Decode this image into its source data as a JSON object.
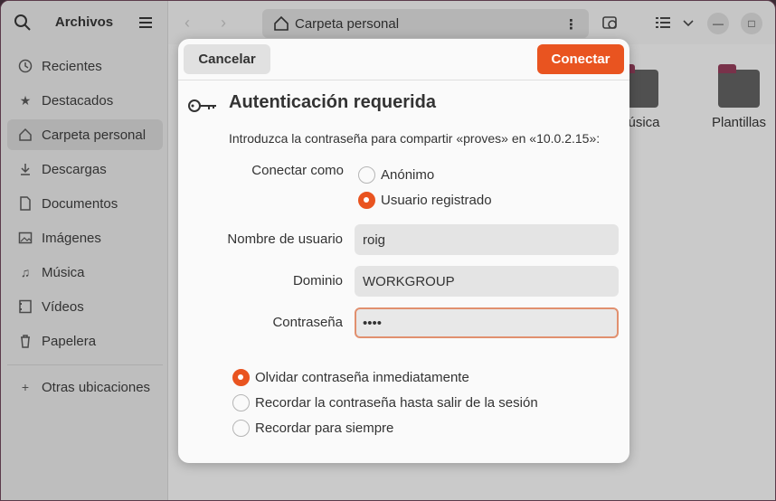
{
  "sidebar": {
    "title": "Archivos",
    "items": [
      {
        "label": "Recientes",
        "icon": "clock-icon"
      },
      {
        "label": "Destacados",
        "icon": "star-icon"
      },
      {
        "label": "Carpeta personal",
        "icon": "home-icon"
      },
      {
        "label": "Descargas",
        "icon": "download-icon"
      },
      {
        "label": "Documentos",
        "icon": "document-icon"
      },
      {
        "label": "Imágenes",
        "icon": "image-icon"
      },
      {
        "label": "Música",
        "icon": "music-icon"
      },
      {
        "label": "Vídeos",
        "icon": "video-icon"
      },
      {
        "label": "Papelera",
        "icon": "trash-icon"
      }
    ],
    "other_locations": "Otras ubicaciones"
  },
  "header": {
    "path": "Carpeta personal"
  },
  "content": {
    "folders": [
      {
        "label": "Música"
      },
      {
        "label": "Plantillas"
      }
    ]
  },
  "dialog": {
    "cancel_label": "Cancelar",
    "connect_label": "Conectar",
    "title": "Autenticación requerida",
    "description": "Introduzca la contraseña para compartir «proves» en «10.0.2.15»:",
    "connect_as_label": "Conectar como",
    "connect_as_options": [
      {
        "label": "Anónimo",
        "selected": false
      },
      {
        "label": "Usuario registrado",
        "selected": true
      }
    ],
    "username_label": "Nombre de usuario",
    "username_value": "roig",
    "domain_label": "Dominio",
    "domain_value": "WORKGROUP",
    "password_label": "Contraseña",
    "password_value": "••••",
    "remember_options": [
      {
        "label": "Olvidar contraseña inmediatamente",
        "selected": true
      },
      {
        "label": "Recordar la contraseña hasta salir de la sesión",
        "selected": false
      },
      {
        "label": "Recordar para siempre",
        "selected": false
      }
    ]
  },
  "colors": {
    "accent": "#e95420",
    "folder_tab": "#8a3a55"
  }
}
